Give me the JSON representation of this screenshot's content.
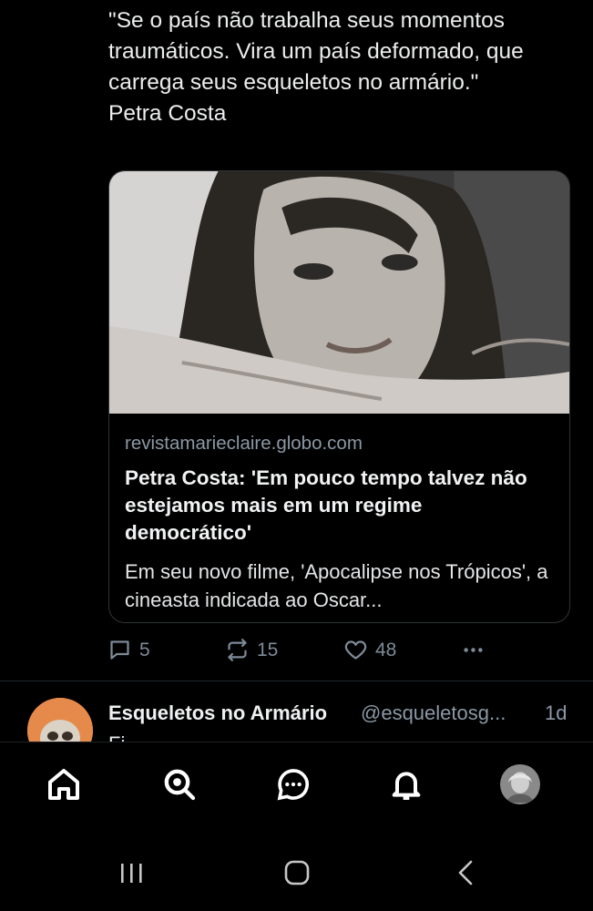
{
  "post": {
    "text": "\"Se o país não trabalha seus momentos traumáticos. Vira um país deformado, que carrega seus esqueletos no armário.\"\nPetra Costa"
  },
  "link_card": {
    "image_icon": "portrait-photo",
    "domain": "revistamarieclaire.globo.com",
    "title": "Petra Costa: 'Em pouco tempo talvez não estejamos mais em um regime democrático'",
    "description": "Em seu novo filme, 'Apocalipse nos Trópicos', a cineasta indicada ao Oscar..."
  },
  "actions": {
    "reply_icon": "speech-bubble-icon",
    "reply_count": "5",
    "repost_icon": "repost-icon",
    "repost_count": "15",
    "like_icon": "heart-icon",
    "like_count": "48",
    "more_icon": "more-dots-icon"
  },
  "next_post": {
    "avatar_icon": "skull-avatar",
    "name": "Esqueletos no Armário",
    "handle": "@esqueletosg...",
    "time": "1d",
    "body": "Fi"
  },
  "tabbar": {
    "home_icon": "home-icon",
    "search_icon": "search-icon",
    "chat_icon": "chat-icon",
    "notifications_icon": "bell-icon",
    "profile_icon": "profile-avatar"
  },
  "system_nav": {
    "recent_icon": "recent-apps-icon",
    "home_icon": "system-home-icon",
    "back_icon": "back-icon"
  },
  "colors": {
    "background": "#000000",
    "text": "#e7e9ea",
    "muted": "#8b98a5",
    "border": "#2f3336"
  }
}
